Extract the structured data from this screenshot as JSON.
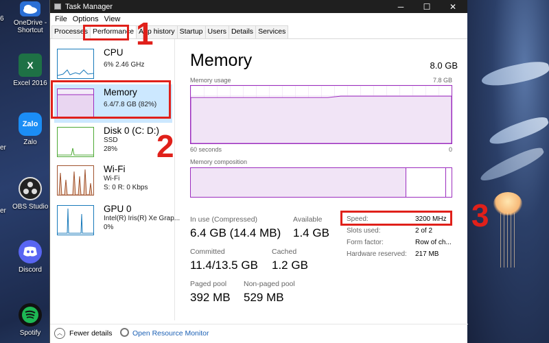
{
  "desktop": {
    "icons": [
      {
        "label": "OneDrive -",
        "label2": "Shortcut",
        "icon": "onedrive-icon",
        "color": "#2a6fd6"
      },
      {
        "label": "Excel 2016",
        "icon": "excel-icon",
        "glyph": "X",
        "color": "#1e7145"
      },
      {
        "label": "Zalo",
        "icon": "zalo-icon",
        "glyph": "Zalo",
        "color": "#1b8df5"
      },
      {
        "label": "OBS Studio",
        "icon": "obs-icon",
        "color": "#222"
      },
      {
        "label": "Discord",
        "icon": "discord-icon",
        "color": "#5865f2"
      },
      {
        "label": "Spotify",
        "icon": "spotify-icon",
        "color": "#1db954"
      }
    ],
    "cut_labels": [
      "6",
      "er",
      "er"
    ]
  },
  "window": {
    "title": "Task Manager",
    "controls": [
      "─",
      "☐",
      "✕"
    ]
  },
  "menu": [
    "File",
    "Options",
    "View"
  ],
  "tabs": [
    "Processes",
    "Performance",
    "App history",
    "Startup",
    "Users",
    "Details",
    "Services"
  ],
  "sidebar": {
    "items": [
      {
        "name": "CPU",
        "sub1": "6%  2.46 GHz",
        "color": "#1779ba"
      },
      {
        "name": "Memory",
        "sub1": "6.4/7.8 GB (82%)",
        "color": "#9b2bbe"
      },
      {
        "name": "Disk 0 (C: D:)",
        "sub1": "SSD",
        "sub2": "28%",
        "color": "#4da934"
      },
      {
        "name": "Wi-Fi",
        "sub1": "Wi-Fi",
        "sub2": "S: 0  R: 0 Kbps",
        "color": "#a0522d"
      },
      {
        "name": "GPU 0",
        "sub1": "Intel(R) Iris(R) Xe Grap...",
        "sub2": "0%",
        "color": "#1779ba"
      }
    ]
  },
  "main": {
    "title": "Memory",
    "total": "8.0 GB",
    "usage_label": "Memory usage",
    "usage_max": "7.8 GB",
    "axis_left": "60 seconds",
    "axis_right": "0",
    "composition_label": "Memory composition",
    "usage_fraction": 0.82,
    "stats": {
      "in_use_label": "In use (Compressed)",
      "in_use_value": "6.4 GB (14.4 MB)",
      "available_label": "Available",
      "available_value": "1.4 GB",
      "committed_label": "Committed",
      "committed_value": "11.4/13.5 GB",
      "cached_label": "Cached",
      "cached_value": "1.2 GB",
      "paged_label": "Paged pool",
      "paged_value": "392 MB",
      "nonpaged_label": "Non-paged pool",
      "nonpaged_value": "529 MB"
    },
    "details": [
      {
        "key": "Speed:",
        "value": "3200 MHz"
      },
      {
        "key": "Slots used:",
        "value": "2 of 2"
      },
      {
        "key": "Form factor:",
        "value": "Row of ch..."
      },
      {
        "key": "Hardware reserved:",
        "value": "217 MB"
      }
    ]
  },
  "footer": {
    "fewer_details": "Fewer details",
    "open_monitor": "Open Resource Monitor"
  },
  "annotations": [
    "1",
    "2",
    "3"
  ],
  "colors": {
    "accent": "#9b2bbe",
    "annotation": "#e0201a",
    "selected": "#cce8ff"
  }
}
